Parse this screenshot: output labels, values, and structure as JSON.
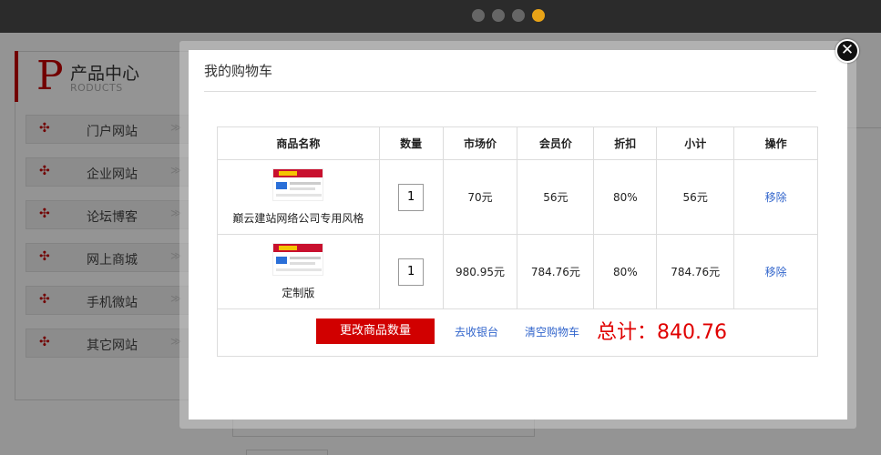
{
  "carousel": {
    "dot_count": 4,
    "active_index": 3
  },
  "colors": {
    "accent_red": "#c40000",
    "link_blue": "#3366cc",
    "total_red": "#e00000"
  },
  "sidebar": {
    "heading_letter": "P",
    "heading_title": "产品中心",
    "heading_sub": "RODUCTS",
    "items": [
      {
        "label": "门户网站"
      },
      {
        "label": "企业网站"
      },
      {
        "label": "论坛博客"
      },
      {
        "label": "网上商城"
      },
      {
        "label": "手机微站"
      },
      {
        "label": "其它网站"
      }
    ]
  },
  "modal": {
    "title": "我的购物车",
    "close_icon": "close-icon"
  },
  "cart": {
    "headers": {
      "name": "商品名称",
      "qty": "数量",
      "market": "市场价",
      "member": "会员价",
      "discount": "折扣",
      "subtotal": "小计",
      "action": "操作"
    },
    "rows": [
      {
        "name": "巅云建站网络公司专用风格",
        "qty": "1",
        "market": "70元",
        "member": "56元",
        "discount": "80%",
        "subtotal": "56元",
        "action": "移除"
      },
      {
        "name": "定制版",
        "qty": "1",
        "market": "980.95元",
        "member": "784.76元",
        "discount": "80%",
        "subtotal": "784.76元",
        "action": "移除"
      }
    ],
    "update_label": "更改商品数量",
    "checkout_label": "去收银台",
    "clear_label": "清空购物车",
    "total_text": "总计：840.76"
  }
}
